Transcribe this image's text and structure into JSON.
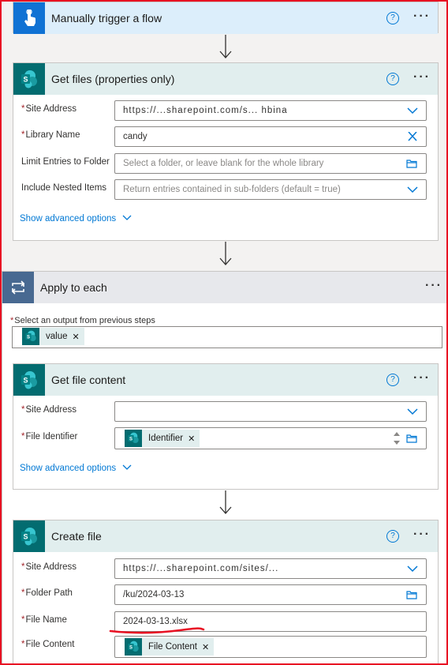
{
  "trigger": {
    "title": "Manually trigger a flow",
    "icon": "touch-icon"
  },
  "get_files": {
    "title": "Get files (properties only)",
    "fields": {
      "site_address": {
        "label": "Site Address",
        "value": "https://...sharepoint.com/s...              hbina"
      },
      "library_name": {
        "label": "Library Name",
        "value": "candy"
      },
      "limit_entries": {
        "label": "Limit Entries to Folder",
        "placeholder": "Select a folder, or leave blank for the whole library"
      },
      "include_nested": {
        "label": "Include Nested Items",
        "placeholder": "Return entries contained in sub-folders (default = true)"
      }
    },
    "advanced": "Show advanced options"
  },
  "apply_each": {
    "title": "Apply to each",
    "select_label": "Select an output from previous steps",
    "token": "value"
  },
  "get_file_content": {
    "title": "Get file content",
    "fields": {
      "site_address": {
        "label": "Site Address",
        "value": ""
      },
      "file_identifier": {
        "label": "File Identifier",
        "token": "Identifier"
      }
    },
    "advanced": "Show advanced options"
  },
  "create_file": {
    "title": "Create file",
    "fields": {
      "site_address": {
        "label": "Site Address",
        "value": "https://...sharepoint.com/sites/..."
      },
      "folder_path": {
        "label": "Folder Path",
        "value": "/ku/2024-03-13"
      },
      "file_name": {
        "label": "File Name",
        "value": "2024-03-13.xlsx"
      },
      "file_content": {
        "label": "File Content",
        "token": "File Content"
      }
    }
  },
  "colors": {
    "trigger_blue": "#1072d4",
    "sharepoint_teal": "#036c70",
    "loop_blue": "#486991",
    "link_blue": "#0078d4",
    "required_red": "#a4262c",
    "annotation_red": "#e81123"
  }
}
